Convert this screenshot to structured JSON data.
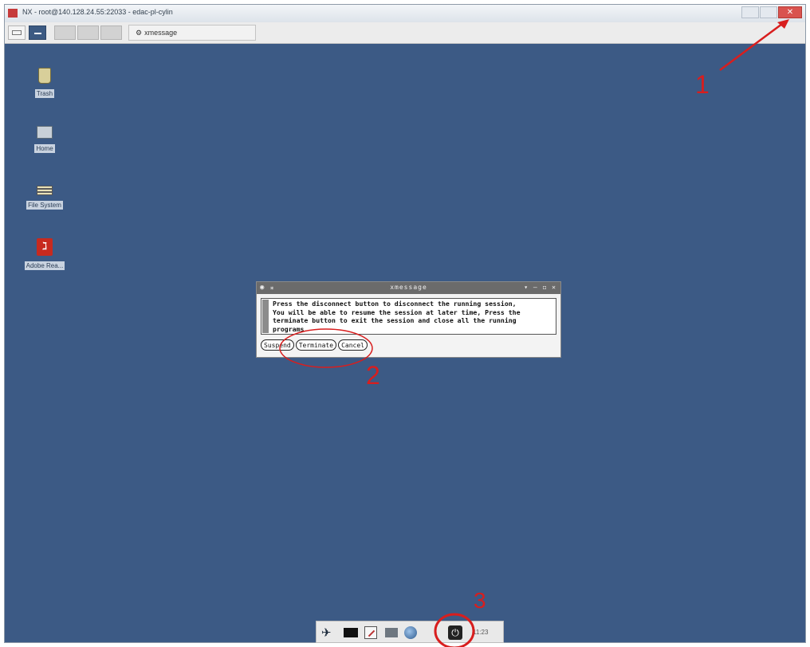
{
  "window": {
    "title": "NX - root@140.128.24.55:22033 - edac-pl-cylin",
    "close_glyph": "✕"
  },
  "top_panel": {
    "active_task": "xmessage",
    "task_icon": "gear-icon",
    "task_icon_glyph": "⚙"
  },
  "desktop": {
    "background_color": "#3c5a85",
    "icons": [
      {
        "label": "Trash",
        "icon": "trash-icon"
      },
      {
        "label": "Home",
        "icon": "home-folder-icon"
      },
      {
        "label": "File System",
        "icon": "drive-icon"
      },
      {
        "label": "Adobe Rea...",
        "icon": "adobe-reader-icon",
        "glyph": "ℷ"
      }
    ]
  },
  "dialog": {
    "title": "xmessage",
    "title_left_glyph": "◉ ⁎",
    "title_right_glyphs": "▾ – ◻ ✕",
    "message_lines": [
      "Press the disconnect button to disconnect the running session,",
      "You will be able to resume the session at later time, Press the",
      "terminate button to exit the session and close all the running",
      "programs."
    ],
    "buttons": [
      "Suspend",
      "Terminate",
      "Cancel"
    ]
  },
  "tray": {
    "clock": "11:23",
    "bird_glyph": "✈",
    "power_glyph": "⏻"
  },
  "annotations": {
    "labels": [
      "1",
      "2",
      "3"
    ],
    "color": "#d81e1e"
  }
}
